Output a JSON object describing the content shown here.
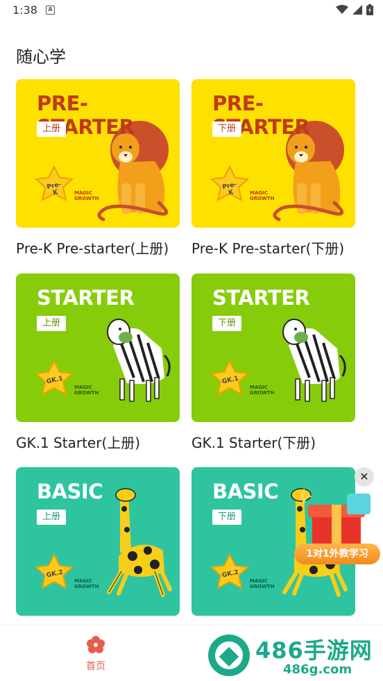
{
  "status_bar": {
    "time": "1:38",
    "notification_icon": "a-icon",
    "icons": [
      "wifi-icon",
      "signal-icon",
      "battery-icon"
    ]
  },
  "section": {
    "title": "随心学"
  },
  "courses": [
    {
      "level": "PRE-STARTER",
      "volume": "上册",
      "badge": "Pre-K",
      "caption": "Pre-K Pre-starter(上册)",
      "color": "#FFE100",
      "animal": "lion-illustration"
    },
    {
      "level": "PRE-STARTER",
      "volume": "下册",
      "badge": "Pre-K",
      "caption": "Pre-K Pre-starter(下册)",
      "color": "#FFE100",
      "animal": "lion-illustration"
    },
    {
      "level": "STARTER",
      "volume": "上册",
      "badge": "GK.1",
      "caption": "GK.1 Starter(上册)",
      "color": "#86CC0A",
      "animal": "zebra-illustration"
    },
    {
      "level": "STARTER",
      "volume": "下册",
      "badge": "GK.1",
      "caption": "GK.1 Starter(下册)",
      "color": "#86CC0A",
      "animal": "zebra-illustration"
    },
    {
      "level": "BASIC",
      "volume": "上册",
      "badge": "GK.2",
      "caption": "",
      "color": "#2EC4A0",
      "animal": "giraffe-illustration"
    },
    {
      "level": "BASIC",
      "volume": "下册",
      "badge": "GK.2",
      "caption": "",
      "color": "#2EC4A0",
      "animal": "giraffe-illustration"
    }
  ],
  "brand_mark": {
    "line1": "MAGIC",
    "line2": "GROWTH"
  },
  "promo": {
    "label": "1对1外教学习",
    "close": "✕"
  },
  "bottom_nav": {
    "home_label": "首页",
    "accent": "#E85A4F"
  },
  "watermark": {
    "title": "486手游网",
    "url": "486g.com",
    "color": "#1BA98A"
  }
}
